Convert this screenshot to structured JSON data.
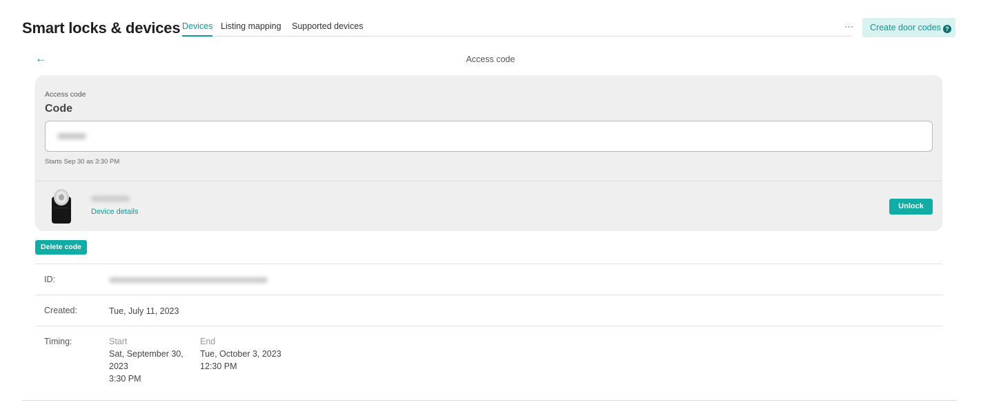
{
  "header": {
    "title": "Smart locks & devices",
    "tabs": [
      {
        "label": "Devices",
        "active": true
      },
      {
        "label": "Listing mapping",
        "active": false
      },
      {
        "label": "Supported devices",
        "active": false
      }
    ],
    "more_label": "···",
    "create_button_label": "Create door codes",
    "help_icon": "?"
  },
  "back_icon": "←",
  "page_subtitle": "Access code",
  "access_card": {
    "label": "Access code",
    "heading": "Code",
    "code_value": "",
    "starts_text": "Starts Sep 30 as 3:30 PM",
    "device_name": "",
    "device_details_link": "Device details",
    "unlock_label": "Unlock"
  },
  "delete_code_label": "Delete code",
  "details": {
    "id_label": "ID:",
    "id_value": "",
    "created_label": "Created:",
    "created_value": "Tue, July 11, 2023",
    "timing_label": "Timing:",
    "start_heading": "Start",
    "start_date_line1": "Sat, September 30,",
    "start_date_line2": "2023",
    "start_time": "3:30 PM",
    "end_heading": "End",
    "end_date": "Tue, October 3, 2023",
    "end_time": "12:30 PM"
  },
  "colors": {
    "accent": "#10aca6",
    "accent_text": "#0b9c95",
    "card_bg": "#efefef",
    "create_button_bg": "#d8f2f0"
  }
}
